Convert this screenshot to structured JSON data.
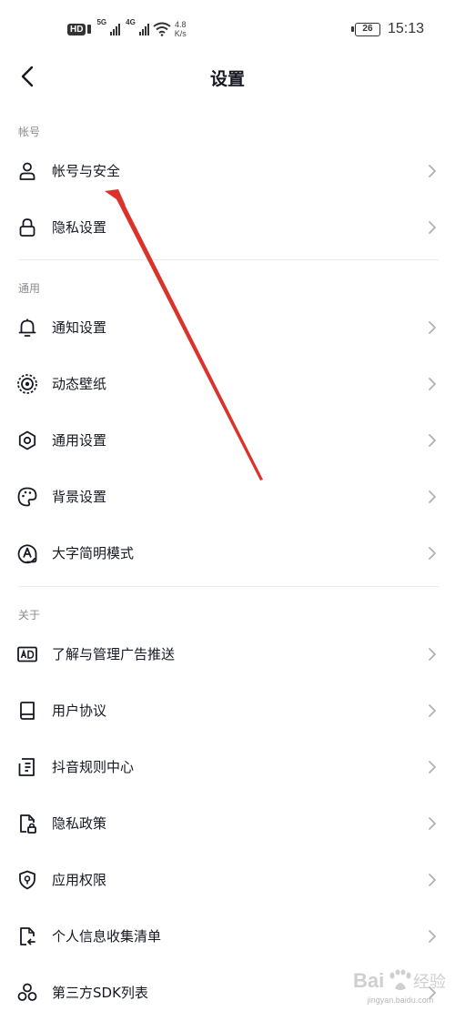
{
  "status_bar": {
    "hd_badge": "HD",
    "net_type_1": "5G",
    "net_type_2": "4G",
    "speed_value": "4.8",
    "speed_unit": "K/s",
    "battery": "26",
    "time": "15:13"
  },
  "nav": {
    "title": "设置",
    "back_icon": "chevron-left-icon"
  },
  "sections": {
    "account": {
      "header": "帐号",
      "items": [
        {
          "label": "帐号与安全",
          "icon": "user-icon"
        },
        {
          "label": "隐私设置",
          "icon": "lock-icon"
        }
      ]
    },
    "general": {
      "header": "通用",
      "items": [
        {
          "label": "通知设置",
          "icon": "bell-icon"
        },
        {
          "label": "动态壁纸",
          "icon": "live-wallpaper-icon"
        },
        {
          "label": "通用设置",
          "icon": "gear-icon"
        },
        {
          "label": "背景设置",
          "icon": "palette-icon"
        },
        {
          "label": "大字简明模式",
          "icon": "font-size-icon"
        }
      ]
    },
    "about": {
      "header": "关于",
      "items": [
        {
          "label": "了解与管理广告推送",
          "icon": "ad-icon"
        },
        {
          "label": "用户协议",
          "icon": "book-icon"
        },
        {
          "label": "抖音规则中心",
          "icon": "rules-document-icon"
        },
        {
          "label": "隐私政策",
          "icon": "privacy-document-icon"
        },
        {
          "label": "应用权限",
          "icon": "shield-icon"
        },
        {
          "label": "个人信息收集清单",
          "icon": "file-export-icon"
        },
        {
          "label": "第三方SDK列表",
          "icon": "sdk-icon"
        }
      ]
    }
  },
  "watermark": {
    "url": "jingyan.baidu.com"
  },
  "colors": {
    "text_primary": "#161823",
    "section_header": "#8a8b91",
    "chevron": "#b0b1b5",
    "divider": "#ebebeb",
    "annotation_arrow": "#d9332b"
  }
}
